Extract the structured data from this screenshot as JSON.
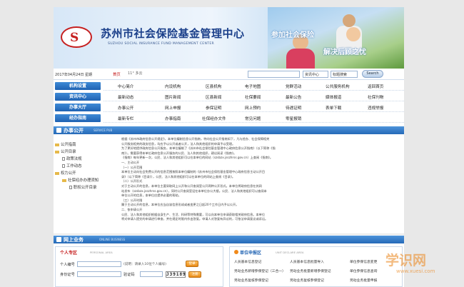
{
  "header": {
    "org_name": "苏州市社会保险基金管理中心",
    "org_en": "SUZHOU SOCIAL INSURANCE FUND MANAGEMENT CENTER",
    "logo_text": "S",
    "slogan1": "参加社会保险",
    "slogan2": "解决后顾之忧"
  },
  "infobar": {
    "date": "2017年04月24日 星期",
    "home": "首页",
    "weather": "11° 多云",
    "search_placeholder": "",
    "select1": "资讯中心",
    "select2": "标题搜索",
    "search_button": "Search"
  },
  "nav": [
    {
      "head": "机构设置",
      "items": [
        "中心简介",
        "内设机构",
        "区县机构",
        "电子地图",
        "党群活动",
        "公共服务机构",
        "返回首页"
      ]
    },
    {
      "head": "资讯中心",
      "items": [
        "最新动态",
        "图片新闻",
        "区县新闻",
        "社保要闻",
        "最新公告",
        "媒体报道",
        "社保刊物"
      ]
    },
    {
      "head": "办事大厅",
      "items": [
        "办事公开",
        "网上申报",
        "参保证明",
        "网上预约",
        "待遇证明",
        "表单下载",
        "违规举报"
      ]
    },
    {
      "head": "经办指南",
      "items": [
        "最新专栏",
        "办事指南",
        "社保经办文件",
        "常见问题",
        "零星报销",
        "异地结算"
      ]
    }
  ],
  "section1": {
    "title": "办事公开",
    "title_en": "SERVICE PUB"
  },
  "tree": [
    "公开指南",
    "公开目录",
    "政策法规",
    "工作动态",
    "权力公开",
    "社保经办办理须知",
    "职权公开目录"
  ],
  "doc_lines": [
    "根据《苏州市政府信息公开规定》，本单位编制信息公开指南，特向社会公开指南如下，凡与经办、社会保障相关",
    "公开服务相关的政务信息，均应予以公开或者公开，法人和其他组织的申请予以受理。",
    "为了更好地提供政府信息公开服务，本单位编制了《苏州市社会保险基金管理中心政府信息公开指南》（以下简称《指",
    "南》）。需要获得本单位政府信息公开服务的公民、法人和其他组织，建议阅读《指南》。",
    "《指南》每年更新一次，公民、法人和其他组织可以在本单位的网站（szsbzx.jsszhrss.gov.cn）上查阅《指南》。",
    "一、主动公开",
    "（一）公开范围",
    "本单位主动向社会免费公开的信息范围按照本单位编制的《苏州市社会保险基金管理中心政府信息主动公开目",
    "录》（以下简称《目录》），公民、法人和其他组织可以在本单位的网站上查阅《目录》。",
    "（二）公开形式",
    "对于主动公开的信息，本单位主要采取网上公开和公开查阅室公开两种公开形式。本单位将政府信息在其网",
    "站发布（szsbzx.jsszhrss.gov.cn），同时公开查阅室设在本单位办公大楼。公民、法人和其他组织可以查阅本",
    "单位公开的信息，本单位应提供必要的帮助。",
    "（三）公开时限",
    "属于主动公开的信息，本单位应当自该信息形成或者变更之日起20个工作日内予以公开。",
    "二、依申请公开",
    "公民、法人和其他组织根据自身生产、生活、科研等特殊需要，可以向本单位申请获取相关政府信息。本单位",
    "将对申请人提交的申请进行审查，并在规定时限内作出答复。申请人对答复有异议的，可依法申请复议或诉讼。"
  ],
  "section2": {
    "title": "网上业务",
    "title_en": "ONLINE BUSINESS"
  },
  "personal": {
    "title": "个人专区",
    "title_en": "PERSONAL AREA",
    "id_label": "个人编号",
    "id_hint": "(说明：请录入10位个人编号)",
    "id_btn": "登录",
    "pwd_label": "身份证号",
    "captcha_label": "验证码",
    "captcha": "J39189",
    "reg_btn": "注册"
  },
  "unit": {
    "title": "单位申报区",
    "title_en": "UNIT DECLARE AREA",
    "col1": [
      "人员基本信息登记",
      "另动业务新增参保登记（三合一）",
      "另动业务复核参保登记"
    ],
    "col2": [
      "人员基本信息批量导入",
      "另动业务批量新增参保登记",
      "另动业务复核参保登记"
    ],
    "col3": [
      "单位参保信息变更",
      "单位参保信息查询",
      "另动业务批量申报"
    ]
  },
  "watermark": {
    "main": "学识网",
    "sub": "www.xuesi.com"
  }
}
